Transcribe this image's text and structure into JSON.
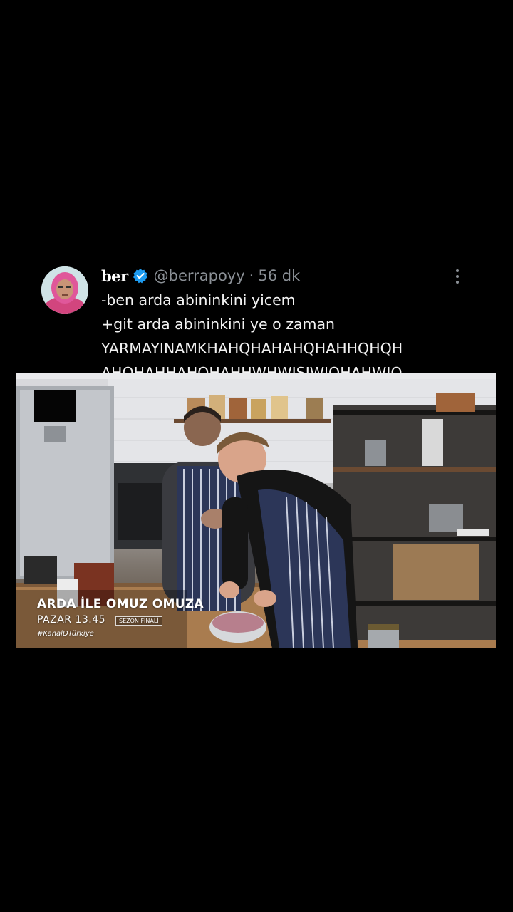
{
  "tweet": {
    "display_name": "ber",
    "handle": "@berrapoyy",
    "separator": "·",
    "time": "56 dk",
    "verified_icon": "verified-badge-icon",
    "more_icon": "more-options-icon",
    "lines": [
      "-ben arda abininkini yicem",
      "+git arda abininkini ye o zaman",
      "YARMAYINAMKHAHQHAHAHQHAHHQHQH",
      "AHQHAHHAHQHAHHWHWJSJWIQHAHWJQ"
    ]
  },
  "video": {
    "overlay_title": "ARDA İLE OMUZ OMUZA",
    "overlay_time": "PAZAR 13.45",
    "overlay_badge": "SEZON FİNALİ",
    "overlay_tag": "#KanalDTürkiye"
  },
  "colors": {
    "background": "#000000",
    "text": "#f2f2f2",
    "muted": "#8b9096",
    "verified": "#1d9bf0"
  }
}
